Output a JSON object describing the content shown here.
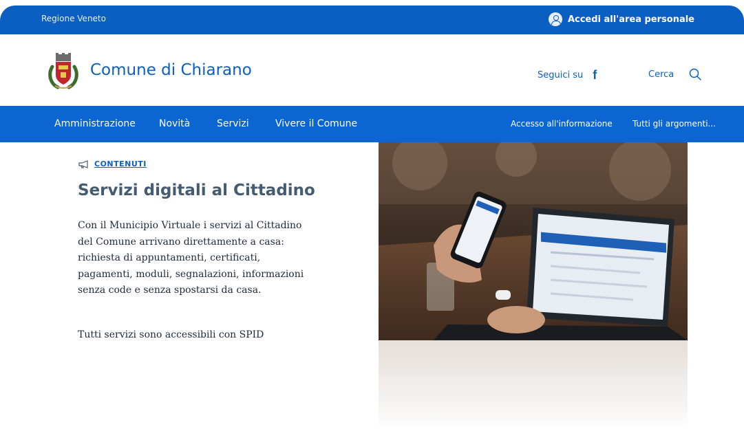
{
  "topbar": {
    "region": "Regione Veneto",
    "login_label": "Accedi all'area personale"
  },
  "header": {
    "site_title": "Comune di Chiarano",
    "social_label": "Seguici su",
    "social_icon": "facebook-icon",
    "search_label": "Cerca",
    "search_icon": "search-icon"
  },
  "nav": {
    "items": [
      "Amministrazione",
      "Novità",
      "Servizi",
      "Vivere il Comune"
    ],
    "right_items": [
      "Accesso all'informazione",
      "Tutti gli argomenti..."
    ]
  },
  "hero": {
    "kicker": "CONTENUTI",
    "kicker_icon": "megaphone-icon",
    "title": "Servizi digitali al Cittadino",
    "lead": "Con il Municipio Virtuale i servizi al Cittadino del Comune arrivano direttamente a casa: richiesta di appuntamenti, certificati, pagamenti, moduli, segnalazioni, informazioni senza code e senza spostarsi da casa.",
    "lead2": "Tutti servizi sono accessibili con SPID"
  },
  "colors": {
    "brand": "#0b5fc2",
    "nav": "#0b66d1",
    "title_gray": "#455b71"
  }
}
